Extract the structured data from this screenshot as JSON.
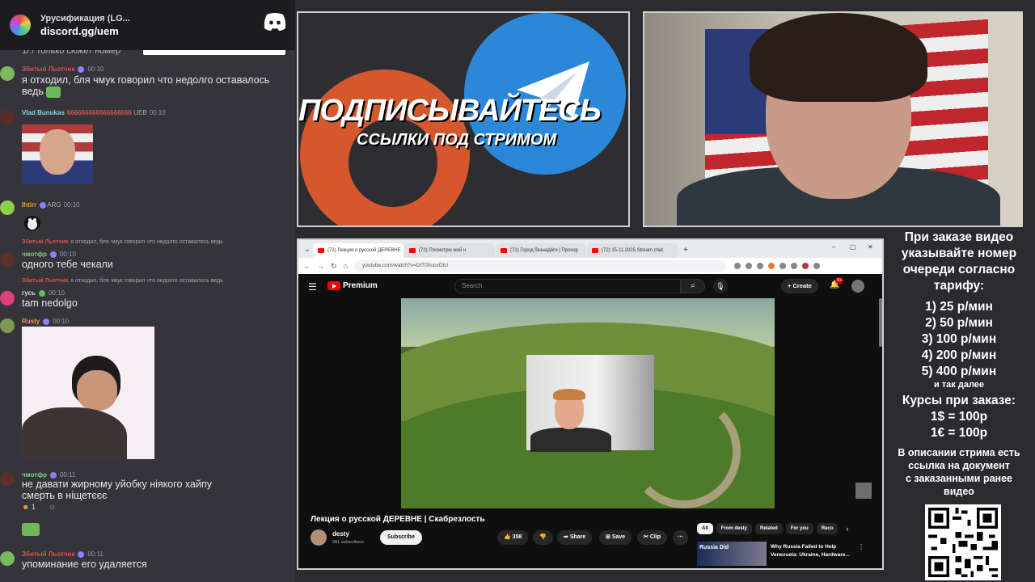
{
  "discord": {
    "title": "Урусификация (LG...",
    "link": "discord.gg/uem"
  },
  "chat": {
    "cut_top": "1/ / только сюжет номер",
    "messages": [
      {
        "name": "Збитый Льотчик",
        "time": "00:10",
        "text": "я отходил, бля чмук говорил что недолго оставалось",
        "text2": "ведь"
      },
      {
        "name": "Vlad Bunukas",
        "badge": "666666666666666666",
        "tag": "UEB",
        "time": "00:10"
      },
      {
        "name": "Ihtirr",
        "tag": "ARG",
        "time": "00:10"
      },
      {
        "reply_name": "Збитый Льотчик",
        "reply_text": "я отходил, бля чмук говорил что недолго оставалось ведь",
        "name": "чмотфр",
        "time": "00:10",
        "text": "одного тебе чекали"
      },
      {
        "reply_name": "Збитый Льотчик",
        "reply_text": "я отходил, бля чмук говорил что недолго оставалось ведь",
        "name": "гусь",
        "time": "00:10",
        "text": "tam nedolgo"
      },
      {
        "name": "Rusty",
        "time": "00:10"
      },
      {
        "name": "чмотфр",
        "time": "00:11",
        "text": "не давати жирному уйобку ніякого хайпу",
        "text2": "смерть в ніщетєєє",
        "reaction_count": "1"
      },
      {
        "name": "Збитый Льотчик",
        "time": "00:11",
        "text": "упоминание его удаляется"
      }
    ]
  },
  "promo": {
    "title": "ПОДПИСЫВАЙТЕСЬ",
    "subtitle": "ССЫЛКИ ПОД СТРИМОМ"
  },
  "browser": {
    "tabs": [
      "(72) Лекция о русской ДЕРЕВНЕ",
      "(72) Посмотрю мой н",
      "(72) Город безнадёги | Прохор",
      "(72) 15.11.2025 Stream chat"
    ],
    "url": "youtube.com/watch?v=DtT00ocvOtU",
    "youtube": {
      "brand": "Premium",
      "search_placeholder": "Search",
      "create": "Create",
      "notif_count": "9+",
      "video_title": "Лекция о русской ДЕРЕВНЕ | Скабрезлость",
      "channel": "desty",
      "subs": "981 subscribers",
      "subscribe": "Subscribe",
      "likes": "358",
      "share": "Share",
      "save": "Save",
      "clip": "Clip",
      "chips": [
        "All",
        "From desty",
        "Related",
        "For you",
        "Reco"
      ],
      "rec_thumb_text": "Russia Did",
      "rec_title": "Why Russia Failed to Help Venezuela: Ukraine, Hardware..."
    }
  },
  "info": {
    "intro": [
      "При заказе видео",
      "указывайте номер",
      "очереди согласно",
      "тарифу:"
    ],
    "tariffs": [
      "1) 25 р/мин",
      "2) 50 р/мин",
      "3) 100 р/мин",
      "4) 200 р/мин",
      "5) 400 р/мин"
    ],
    "etc": "и так далее",
    "rates_title": "Курсы при заказе:",
    "rates": [
      "1$ = 100р",
      "1€ = 100р"
    ],
    "desc": [
      "В описании стрима есть",
      "ссылка на документ",
      "с заказанными ранее",
      "видео"
    ]
  },
  "colors": {
    "chat_bg": "#34343a",
    "accent_red": "#d9534f",
    "yt_red": "#ff0000"
  }
}
